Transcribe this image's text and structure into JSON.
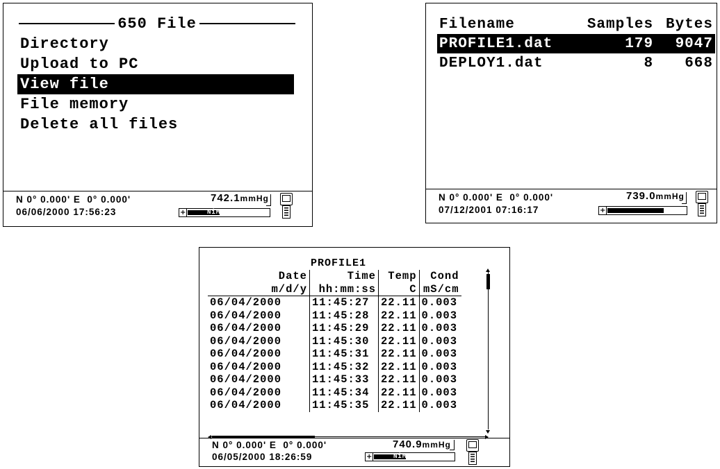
{
  "menu_screen": {
    "title": "650 File",
    "items": [
      {
        "label": "Directory"
      },
      {
        "label": "Upload to PC"
      },
      {
        "label": "View file",
        "selected": true
      },
      {
        "label": "File memory"
      },
      {
        "label": "Delete all files"
      }
    ],
    "status": {
      "gps": "N 0° 0.000' E  0° 0.000'",
      "datetime": "06/06/2000 17:56:23",
      "pressure_value": "742.1",
      "pressure_unit": "mmHg",
      "battery_type": "NiMH",
      "battery_level": 0.4
    }
  },
  "directory_screen": {
    "columns": [
      "Filename",
      "Samples",
      "Bytes"
    ],
    "rows": [
      {
        "filename": "PROFILE1.dat",
        "samples": "179",
        "bytes": "9047",
        "selected": true
      },
      {
        "filename": "DEPLOY1.dat",
        "samples": "8",
        "bytes": "668",
        "selected": false
      }
    ],
    "status": {
      "gps": "N 0° 0.000' E  0° 0.000'",
      "datetime": "07/12/2001 07:16:17",
      "pressure_value": "739.0",
      "pressure_unit": "mmHg",
      "battery_type": "",
      "battery_level": 0.72
    }
  },
  "file_view_screen": {
    "title": "PROFILE1",
    "headers": [
      {
        "name": "Date",
        "unit": "m/d/y"
      },
      {
        "name": "Time",
        "unit": "hh:mm:ss"
      },
      {
        "name": "Temp",
        "unit": "C"
      },
      {
        "name": "Cond",
        "unit": "mS/cm"
      }
    ],
    "rows": [
      [
        "06/04/2000",
        "11:45:27",
        "22.11",
        "0.003"
      ],
      [
        "06/04/2000",
        "11:45:28",
        "22.11",
        "0.003"
      ],
      [
        "06/04/2000",
        "11:45:29",
        "22.11",
        "0.003"
      ],
      [
        "06/04/2000",
        "11:45:30",
        "22.11",
        "0.003"
      ],
      [
        "06/04/2000",
        "11:45:31",
        "22.11",
        "0.003"
      ],
      [
        "06/04/2000",
        "11:45:32",
        "22.11",
        "0.003"
      ],
      [
        "06/04/2000",
        "11:45:33",
        "22.11",
        "0.003"
      ],
      [
        "06/04/2000",
        "11:45:34",
        "22.11",
        "0.003"
      ],
      [
        "06/04/2000",
        "11:45:35",
        "22.11",
        "0.003"
      ]
    ],
    "status": {
      "gps": "N 0° 0.000' E  0° 0.000'",
      "datetime": "06/05/2000 18:26:59",
      "pressure_value": "740.9",
      "pressure_unit": "mmHg",
      "battery_type": "NiMH",
      "battery_level": 0.4
    }
  }
}
